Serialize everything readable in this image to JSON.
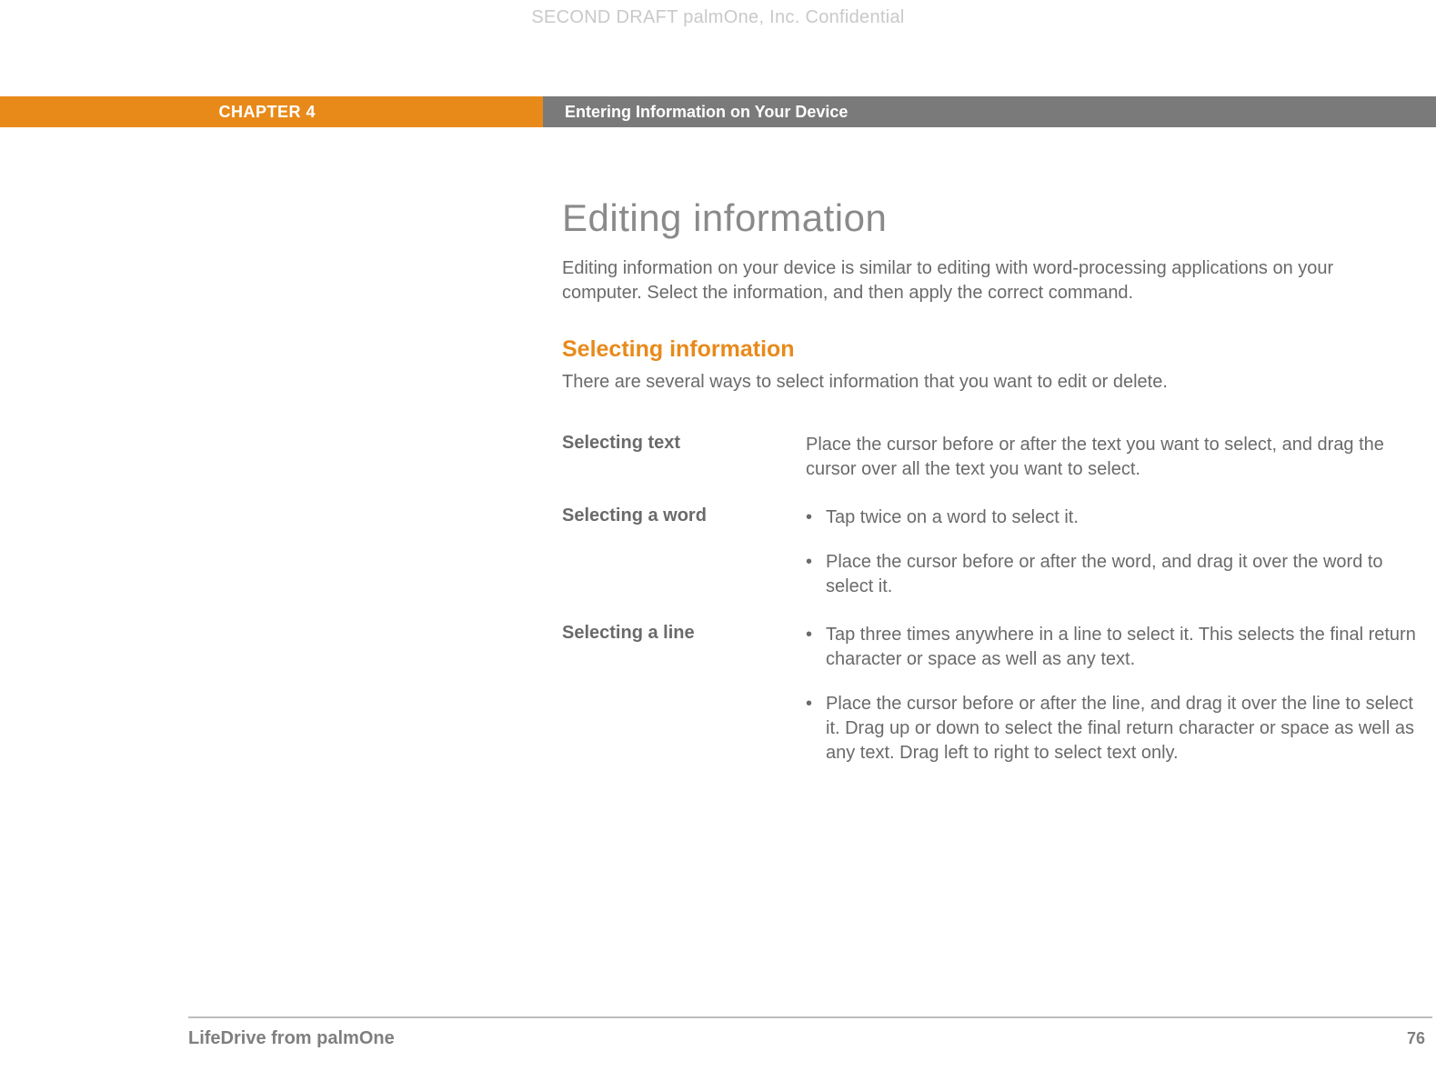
{
  "watermark": "SECOND DRAFT palmOne, Inc.  Confidential",
  "chapter": {
    "label": "CHAPTER 4",
    "title": "Entering Information on Your Device"
  },
  "main": {
    "title": "Editing information",
    "intro": "Editing information on your device is similar to editing with word-processing applications on your computer. Select the information, and then apply the correct command.",
    "subheading": "Selecting information",
    "subintro": "There are several ways to select information that you want to edit or delete.",
    "rows": [
      {
        "label": "Selecting text",
        "text": "Place the cursor before or after the text you want to select, and drag the cursor over all the text you want to select."
      },
      {
        "label": "Selecting a word",
        "bullets": [
          "Tap twice on a word to select it.",
          "Place the cursor before or after the word, and drag it over the word to select it."
        ]
      },
      {
        "label": "Selecting a line",
        "bullets": [
          "Tap three times anywhere in a line to select it. This selects the final return character or space as well as any text.",
          "Place the cursor before or after the line, and drag it over the line to select it. Drag up or down to select the final return character or space as well as any text. Drag left to right to select text only."
        ]
      }
    ]
  },
  "footer": {
    "product": "LifeDrive from palmOne",
    "page": "76"
  }
}
